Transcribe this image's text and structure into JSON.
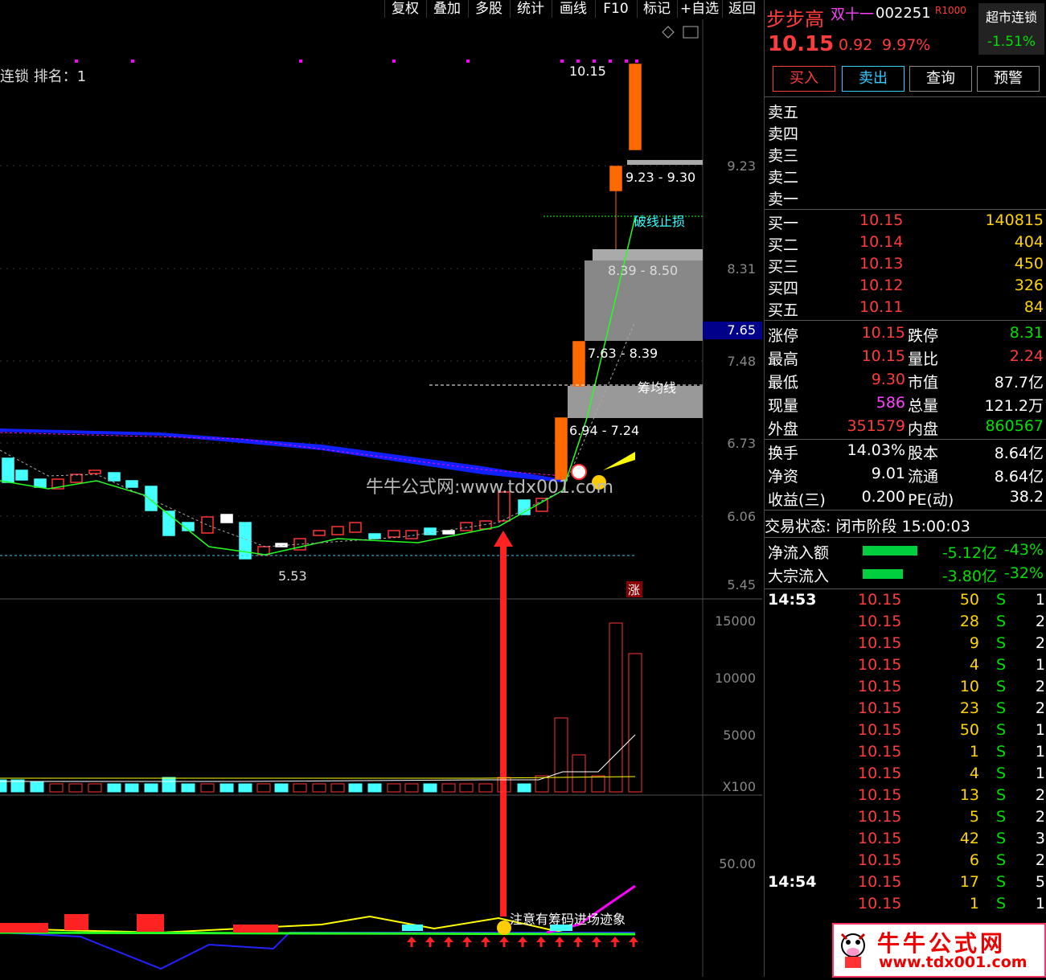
{
  "toolbar": {
    "items": [
      "复权",
      "叠加",
      "多股",
      "统计",
      "画线",
      "F10",
      "标记",
      "+自选",
      "返回"
    ]
  },
  "main": {
    "rank_label": "连锁 排名：1",
    "price_axis": [
      "9.23",
      "8.31",
      "7.65",
      "7.48",
      "6.73",
      "6.06",
      "5.45"
    ],
    "annotations": {
      "top_price": "10.15",
      "zone1": "9.23 - 9.30",
      "stoploss": "破线止损",
      "zone2": "8.39 - 8.50",
      "zone3": "7.63 - 8.39",
      "avg_line": "筹均线",
      "zone4": "6.94 - 7.24",
      "low_price": "5.53",
      "limit_up": "涨",
      "watermark": "牛牛公式网:www.tdx001.com"
    },
    "volume_axis": [
      "15000",
      "10000",
      "5000",
      "X100"
    ],
    "indicator_axis": [
      "50.00"
    ],
    "indicator_note": "注意有筹码进场迹象"
  },
  "side": {
    "title": "步步高",
    "tag": "双十一",
    "code": "002251",
    "badge": "R1000",
    "sector_name": "超市连锁",
    "sector_change": "-1.51%",
    "price": "10.15",
    "change": "0.92",
    "change_pct": "9.97%",
    "buttons": [
      "买入",
      "卖出",
      "查询",
      "预警"
    ],
    "asks": [
      "卖五",
      "卖四",
      "卖三",
      "卖二",
      "卖一"
    ],
    "bids": [
      {
        "label": "买一",
        "price": "10.15",
        "vol": "140815"
      },
      {
        "label": "买二",
        "price": "10.14",
        "vol": "404"
      },
      {
        "label": "买三",
        "price": "10.13",
        "vol": "450"
      },
      {
        "label": "买四",
        "price": "10.12",
        "vol": "326"
      },
      {
        "label": "买五",
        "price": "10.11",
        "vol": "84"
      }
    ],
    "stats": [
      {
        "l1": "涨停",
        "v1": "10.15",
        "l2": "跌停",
        "v2": "8.31"
      },
      {
        "l1": "最高",
        "v1": "10.15",
        "l2": "量比",
        "v2": "2.24"
      },
      {
        "l1": "最低",
        "v1": "9.30",
        "l2": "市值",
        "v2": "87.7亿"
      },
      {
        "l1": "现量",
        "v1": "586",
        "l2": "总量",
        "v2": "121.2万"
      },
      {
        "l1": "外盘",
        "v1": "351579",
        "l2": "内盘",
        "v2": "860567"
      }
    ],
    "stats2": [
      {
        "l1": "换手",
        "v1": "14.03%",
        "l2": "股本",
        "v2": "8.64亿"
      },
      {
        "l1": "净资",
        "v1": "9.01",
        "l2": "流通",
        "v2": "8.64亿"
      },
      {
        "l1": "收益(三)",
        "v1": "0.200",
        "l2": "PE(动)",
        "v2": "38.2"
      }
    ],
    "status": "交易状态: 闭市阶段 15:00:03",
    "flows": [
      {
        "label": "净流入额",
        "value": "-5.12亿",
        "pct": "-43%"
      },
      {
        "label": "大宗流入",
        "value": "-3.80亿",
        "pct": "-32%"
      }
    ],
    "ticks": [
      {
        "time": "14:53",
        "price": "10.15",
        "vol": "50",
        "side": "S",
        "n": "1"
      },
      {
        "time": "",
        "price": "10.15",
        "vol": "28",
        "side": "S",
        "n": "2"
      },
      {
        "time": "",
        "price": "10.15",
        "vol": "9",
        "side": "S",
        "n": "2"
      },
      {
        "time": "",
        "price": "10.15",
        "vol": "4",
        "side": "S",
        "n": "1"
      },
      {
        "time": "",
        "price": "10.15",
        "vol": "10",
        "side": "S",
        "n": "2"
      },
      {
        "time": "",
        "price": "10.15",
        "vol": "23",
        "side": "S",
        "n": "2"
      },
      {
        "time": "",
        "price": "10.15",
        "vol": "50",
        "side": "S",
        "n": "1"
      },
      {
        "time": "",
        "price": "10.15",
        "vol": "1",
        "side": "S",
        "n": "1"
      },
      {
        "time": "",
        "price": "10.15",
        "vol": "4",
        "side": "S",
        "n": "1"
      },
      {
        "time": "",
        "price": "10.15",
        "vol": "13",
        "side": "S",
        "n": "2"
      },
      {
        "time": "",
        "price": "10.15",
        "vol": "5",
        "side": "S",
        "n": "2"
      },
      {
        "time": "",
        "price": "10.15",
        "vol": "42",
        "side": "S",
        "n": "3"
      },
      {
        "time": "",
        "price": "10.15",
        "vol": "6",
        "side": "S",
        "n": "2"
      },
      {
        "time": "14:54",
        "price": "10.15",
        "vol": "17",
        "side": "S",
        "n": "5"
      },
      {
        "time": "",
        "price": "10.15",
        "vol": "1",
        "side": "S",
        "n": "1"
      }
    ],
    "logo_text": "牛牛公式网",
    "logo_url": "www.tdx001.com"
  }
}
